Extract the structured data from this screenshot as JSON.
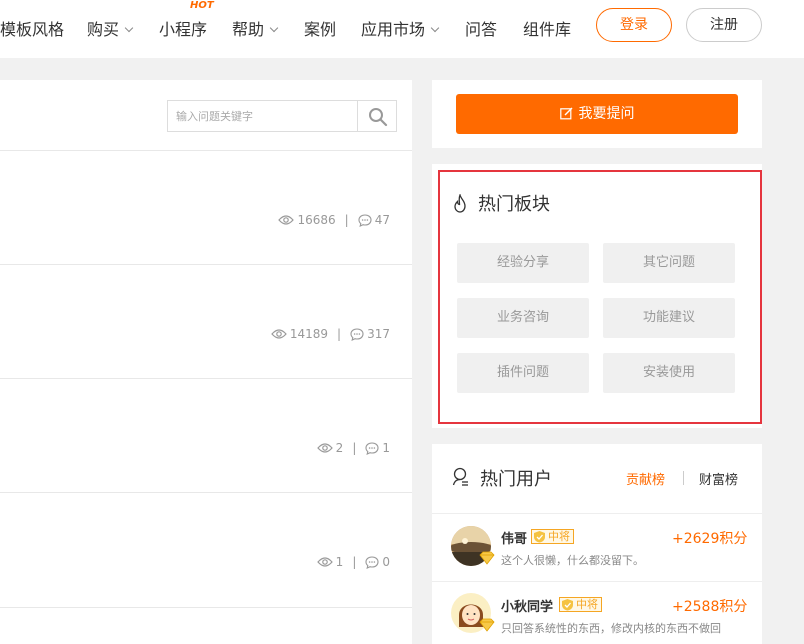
{
  "nav": {
    "items": [
      {
        "label": "模板风格",
        "chevron": false
      },
      {
        "label": "购买",
        "chevron": true
      },
      {
        "label": "小程序",
        "chevron": false
      },
      {
        "label": "帮助",
        "chevron": true
      },
      {
        "label": "案例",
        "chevron": false
      },
      {
        "label": "应用市场",
        "chevron": true
      },
      {
        "label": "问答",
        "chevron": false
      },
      {
        "label": "组件库",
        "chevron": false
      }
    ],
    "hot_badge": "HOT",
    "login": "登录",
    "register": "注册"
  },
  "search": {
    "placeholder": "输入问题关键字"
  },
  "questions": [
    {
      "views": "16686",
      "comments": "47"
    },
    {
      "views": "14189",
      "comments": "317"
    },
    {
      "views": "2",
      "comments": "1"
    },
    {
      "views": "1",
      "comments": "0"
    }
  ],
  "ask_button": "我要提问",
  "hot_board": {
    "title": "热门板块",
    "tags": [
      "经验分享",
      "其它问题",
      "业务咨询",
      "功能建议",
      "插件问题",
      "安装使用"
    ]
  },
  "hot_users": {
    "title": "热门用户",
    "tab_contrib": "贡献榜",
    "tab_wealth": "财富榜",
    "users": [
      {
        "name": "伟哥",
        "level": "中将",
        "points": "+2629积分",
        "desc": "这个人很懒，什么都没留下。"
      },
      {
        "name": "小秋同学",
        "level": "中将",
        "points": "+2588积分",
        "desc": "只回答系统性的东西，修改内核的东西不做回"
      }
    ]
  },
  "colors": {
    "accent": "#ff6a00",
    "highlight_border": "#e5353e",
    "level_gold": "#f5a623"
  }
}
